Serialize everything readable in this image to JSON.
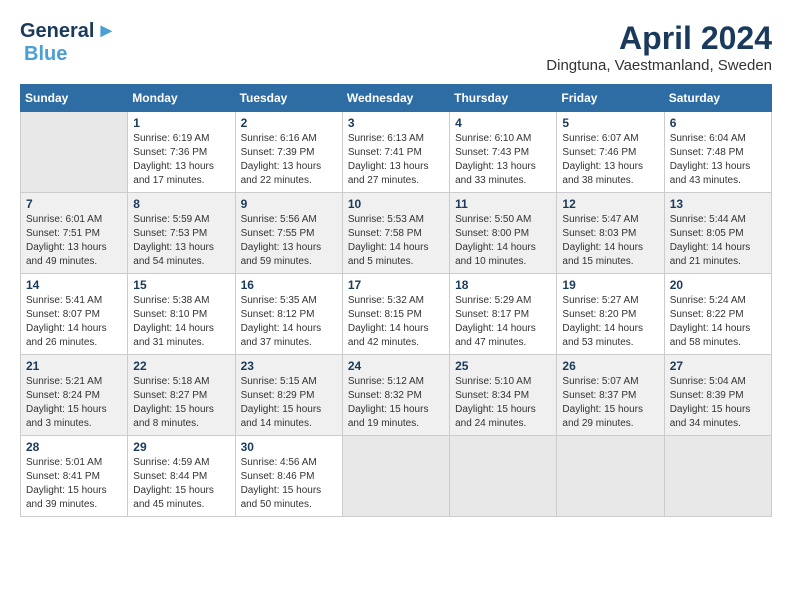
{
  "header": {
    "logo_line1": "General",
    "logo_line2": "Blue",
    "title": "April 2024",
    "subtitle": "Dingtuna, Vaestmanland, Sweden"
  },
  "days_of_week": [
    "Sunday",
    "Monday",
    "Tuesday",
    "Wednesday",
    "Thursday",
    "Friday",
    "Saturday"
  ],
  "weeks": [
    [
      {
        "day": "",
        "empty": true
      },
      {
        "day": "1",
        "sunrise": "Sunrise: 6:19 AM",
        "sunset": "Sunset: 7:36 PM",
        "daylight": "Daylight: 13 hours and 17 minutes."
      },
      {
        "day": "2",
        "sunrise": "Sunrise: 6:16 AM",
        "sunset": "Sunset: 7:39 PM",
        "daylight": "Daylight: 13 hours and 22 minutes."
      },
      {
        "day": "3",
        "sunrise": "Sunrise: 6:13 AM",
        "sunset": "Sunset: 7:41 PM",
        "daylight": "Daylight: 13 hours and 27 minutes."
      },
      {
        "day": "4",
        "sunrise": "Sunrise: 6:10 AM",
        "sunset": "Sunset: 7:43 PM",
        "daylight": "Daylight: 13 hours and 33 minutes."
      },
      {
        "day": "5",
        "sunrise": "Sunrise: 6:07 AM",
        "sunset": "Sunset: 7:46 PM",
        "daylight": "Daylight: 13 hours and 38 minutes."
      },
      {
        "day": "6",
        "sunrise": "Sunrise: 6:04 AM",
        "sunset": "Sunset: 7:48 PM",
        "daylight": "Daylight: 13 hours and 43 minutes."
      }
    ],
    [
      {
        "day": "7",
        "sunrise": "Sunrise: 6:01 AM",
        "sunset": "Sunset: 7:51 PM",
        "daylight": "Daylight: 13 hours and 49 minutes."
      },
      {
        "day": "8",
        "sunrise": "Sunrise: 5:59 AM",
        "sunset": "Sunset: 7:53 PM",
        "daylight": "Daylight: 13 hours and 54 minutes."
      },
      {
        "day": "9",
        "sunrise": "Sunrise: 5:56 AM",
        "sunset": "Sunset: 7:55 PM",
        "daylight": "Daylight: 13 hours and 59 minutes."
      },
      {
        "day": "10",
        "sunrise": "Sunrise: 5:53 AM",
        "sunset": "Sunset: 7:58 PM",
        "daylight": "Daylight: 14 hours and 5 minutes."
      },
      {
        "day": "11",
        "sunrise": "Sunrise: 5:50 AM",
        "sunset": "Sunset: 8:00 PM",
        "daylight": "Daylight: 14 hours and 10 minutes."
      },
      {
        "day": "12",
        "sunrise": "Sunrise: 5:47 AM",
        "sunset": "Sunset: 8:03 PM",
        "daylight": "Daylight: 14 hours and 15 minutes."
      },
      {
        "day": "13",
        "sunrise": "Sunrise: 5:44 AM",
        "sunset": "Sunset: 8:05 PM",
        "daylight": "Daylight: 14 hours and 21 minutes."
      }
    ],
    [
      {
        "day": "14",
        "sunrise": "Sunrise: 5:41 AM",
        "sunset": "Sunset: 8:07 PM",
        "daylight": "Daylight: 14 hours and 26 minutes."
      },
      {
        "day": "15",
        "sunrise": "Sunrise: 5:38 AM",
        "sunset": "Sunset: 8:10 PM",
        "daylight": "Daylight: 14 hours and 31 minutes."
      },
      {
        "day": "16",
        "sunrise": "Sunrise: 5:35 AM",
        "sunset": "Sunset: 8:12 PM",
        "daylight": "Daylight: 14 hours and 37 minutes."
      },
      {
        "day": "17",
        "sunrise": "Sunrise: 5:32 AM",
        "sunset": "Sunset: 8:15 PM",
        "daylight": "Daylight: 14 hours and 42 minutes."
      },
      {
        "day": "18",
        "sunrise": "Sunrise: 5:29 AM",
        "sunset": "Sunset: 8:17 PM",
        "daylight": "Daylight: 14 hours and 47 minutes."
      },
      {
        "day": "19",
        "sunrise": "Sunrise: 5:27 AM",
        "sunset": "Sunset: 8:20 PM",
        "daylight": "Daylight: 14 hours and 53 minutes."
      },
      {
        "day": "20",
        "sunrise": "Sunrise: 5:24 AM",
        "sunset": "Sunset: 8:22 PM",
        "daylight": "Daylight: 14 hours and 58 minutes."
      }
    ],
    [
      {
        "day": "21",
        "sunrise": "Sunrise: 5:21 AM",
        "sunset": "Sunset: 8:24 PM",
        "daylight": "Daylight: 15 hours and 3 minutes."
      },
      {
        "day": "22",
        "sunrise": "Sunrise: 5:18 AM",
        "sunset": "Sunset: 8:27 PM",
        "daylight": "Daylight: 15 hours and 8 minutes."
      },
      {
        "day": "23",
        "sunrise": "Sunrise: 5:15 AM",
        "sunset": "Sunset: 8:29 PM",
        "daylight": "Daylight: 15 hours and 14 minutes."
      },
      {
        "day": "24",
        "sunrise": "Sunrise: 5:12 AM",
        "sunset": "Sunset: 8:32 PM",
        "daylight": "Daylight: 15 hours and 19 minutes."
      },
      {
        "day": "25",
        "sunrise": "Sunrise: 5:10 AM",
        "sunset": "Sunset: 8:34 PM",
        "daylight": "Daylight: 15 hours and 24 minutes."
      },
      {
        "day": "26",
        "sunrise": "Sunrise: 5:07 AM",
        "sunset": "Sunset: 8:37 PM",
        "daylight": "Daylight: 15 hours and 29 minutes."
      },
      {
        "day": "27",
        "sunrise": "Sunrise: 5:04 AM",
        "sunset": "Sunset: 8:39 PM",
        "daylight": "Daylight: 15 hours and 34 minutes."
      }
    ],
    [
      {
        "day": "28",
        "sunrise": "Sunrise: 5:01 AM",
        "sunset": "Sunset: 8:41 PM",
        "daylight": "Daylight: 15 hours and 39 minutes."
      },
      {
        "day": "29",
        "sunrise": "Sunrise: 4:59 AM",
        "sunset": "Sunset: 8:44 PM",
        "daylight": "Daylight: 15 hours and 45 minutes."
      },
      {
        "day": "30",
        "sunrise": "Sunrise: 4:56 AM",
        "sunset": "Sunset: 8:46 PM",
        "daylight": "Daylight: 15 hours and 50 minutes."
      },
      {
        "day": "",
        "empty": true
      },
      {
        "day": "",
        "empty": true
      },
      {
        "day": "",
        "empty": true
      },
      {
        "day": "",
        "empty": true
      }
    ]
  ]
}
